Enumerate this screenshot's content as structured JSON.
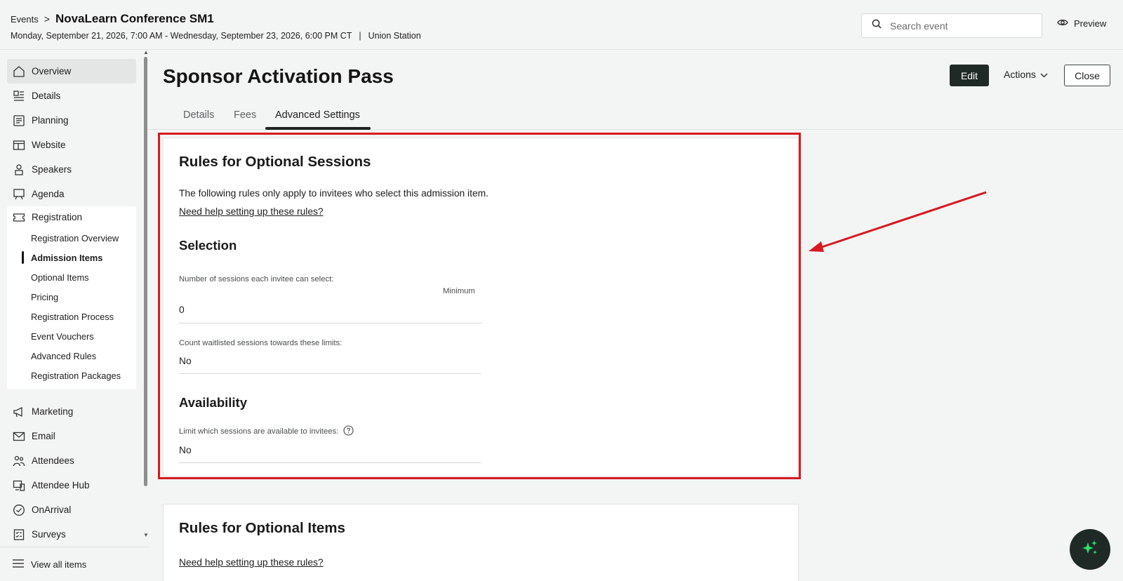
{
  "header": {
    "breadcrumb_root": "Events",
    "breadcrumb_sep": ">",
    "event_title": "NovaLearn Conference SM1",
    "event_dates": "Monday, September 21, 2026, 7:00 AM - Wednesday, September 23, 2026, 6:00 PM CT",
    "date_sep": "|",
    "event_location": "Union Station",
    "search_placeholder": "Search event",
    "preview_label": "Preview"
  },
  "sidebar": {
    "items": [
      {
        "label": "Overview",
        "icon": "home-icon"
      },
      {
        "label": "Details",
        "icon": "details-icon"
      },
      {
        "label": "Planning",
        "icon": "planning-icon"
      },
      {
        "label": "Website",
        "icon": "website-icon"
      },
      {
        "label": "Speakers",
        "icon": "speakers-icon"
      },
      {
        "label": "Agenda",
        "icon": "agenda-icon"
      }
    ],
    "registration": {
      "label": "Registration",
      "icon": "ticket-icon",
      "subitems": [
        "Registration Overview",
        "Admission Items",
        "Optional Items",
        "Pricing",
        "Registration Process",
        "Event Vouchers",
        "Advanced Rules",
        "Registration Packages"
      ]
    },
    "items_after": [
      {
        "label": "Marketing",
        "icon": "megaphone-icon"
      },
      {
        "label": "Email",
        "icon": "email-icon"
      },
      {
        "label": "Attendees",
        "icon": "attendees-icon"
      },
      {
        "label": "Attendee Hub",
        "icon": "attendee-hub-icon"
      },
      {
        "label": "OnArrival",
        "icon": "check-circle-icon"
      },
      {
        "label": "Surveys",
        "icon": "surveys-icon"
      }
    ],
    "view_all": "View all items"
  },
  "main": {
    "title": "Sponsor Activation Pass",
    "edit_label": "Edit",
    "actions_label": "Actions",
    "close_label": "Close",
    "tabs": [
      "Details",
      "Fees",
      "Advanced Settings"
    ],
    "selected_tab": "Advanced Settings",
    "sessions_card": {
      "title": "Rules for Optional Sessions",
      "description": "The following rules only apply to invitees who select this admission item.",
      "help_link": "Need help setting up these rules?",
      "selection_heading": "Selection",
      "num_sessions_label": "Number of sessions each invitee can select:",
      "minimum_caption": "Minimum",
      "minimum_value": "0",
      "waitlist_label": "Count waitlisted sessions towards these limits:",
      "waitlist_value": "No",
      "availability_heading": "Availability",
      "limit_label": "Limit which sessions are available to invitees:",
      "limit_value": "No"
    },
    "items_card": {
      "title": "Rules for Optional Items",
      "help_link": "Need help setting up these rules?"
    }
  },
  "colors": {
    "highlight": "#d71920",
    "dark_button": "#1f2a26",
    "ai_sparkle": "#2ee06b"
  }
}
